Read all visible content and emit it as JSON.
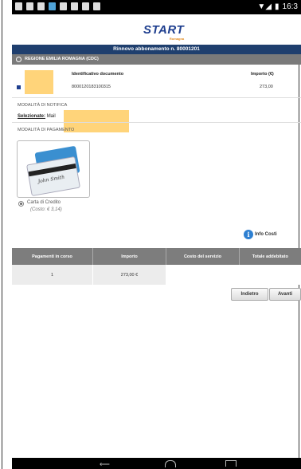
{
  "status_bar": {
    "time": "16:3",
    "icons": [
      "notification-icon",
      "message-icon",
      "calendar-icon",
      "image-icon",
      "signal-icon",
      "battery-icon"
    ]
  },
  "app": {
    "logo_text": "START",
    "logo_subtext": "Romagna",
    "title": "Rinnovo abbonamento n. 80001201"
  },
  "region": {
    "label": "REGIONE EMILIA ROMAGNA (CDC)"
  },
  "documents": {
    "headers": [
      "Identificativo documento",
      "Importo (€)"
    ],
    "rows": [
      {
        "id": "8000120183100315",
        "amount": "273,00"
      }
    ]
  },
  "notification": {
    "section_label": "MODALITÀ DI NOTIFICA",
    "selected_label": "Selezionate:",
    "selected_value": "Mail"
  },
  "payment": {
    "section_label": "MODALITÀ DI PAGAMENTO",
    "card_signature": "John Smith",
    "method_name": "Carta di Credito",
    "method_cost": "(Costo: € 3,14)"
  },
  "info_costi": "Info Costi",
  "table": {
    "headers": [
      "Pagamenti in corso",
      "Importo",
      "Costo del servizio",
      "Totale addebitato"
    ],
    "rows": [
      {
        "count": "1",
        "amount": "273,00 €",
        "service_cost": "",
        "total": ""
      }
    ]
  },
  "buttons": {
    "back": "Indietro",
    "next": "Avanti"
  },
  "colors": {
    "brand": "#1f3f6e",
    "highlight": "#ffd47a",
    "info": "#2d7fd1"
  }
}
